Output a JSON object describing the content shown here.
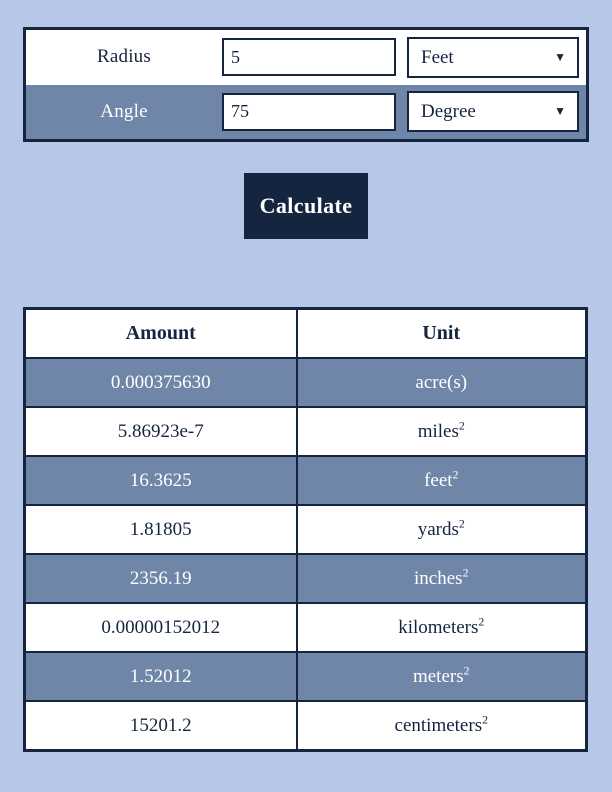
{
  "form": {
    "rows": [
      {
        "label": "Radius",
        "value": "5",
        "placeholder": "",
        "unit": "Feet",
        "caret_icon": "chevron-down-icon"
      },
      {
        "label": "Angle",
        "value": "75",
        "placeholder": "",
        "unit": "Degree",
        "caret_icon": "chevron-down-icon"
      }
    ]
  },
  "actions": {
    "calculate_label": "Calculate"
  },
  "results": {
    "headers": [
      "Amount",
      "Unit"
    ],
    "rows": [
      {
        "amount": "0.000375630",
        "unit": "acre(s)",
        "exponent": ""
      },
      {
        "amount": "5.86923e-7",
        "unit": "miles",
        "exponent": "2"
      },
      {
        "amount": "16.3625",
        "unit": "feet",
        "exponent": "2"
      },
      {
        "amount": "1.81805",
        "unit": "yards",
        "exponent": "2"
      },
      {
        "amount": "2356.19",
        "unit": "inches",
        "exponent": "2"
      },
      {
        "amount": "0.00000152012",
        "unit": "kilometers",
        "exponent": "2"
      },
      {
        "amount": "1.52012",
        "unit": "meters",
        "exponent": "2"
      },
      {
        "amount": "15201.2",
        "unit": "centimeters",
        "exponent": "2"
      }
    ]
  },
  "colors": {
    "page_background": "#b6c7e8",
    "accent_dark": "#15243f",
    "row_stripe": "#6f86a8",
    "surface": "#ffffff"
  }
}
